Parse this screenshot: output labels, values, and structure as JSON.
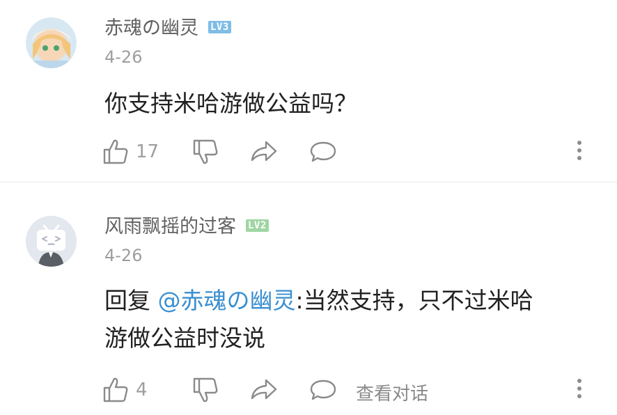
{
  "comments": [
    {
      "username": "赤魂の幽灵",
      "level": "LV3",
      "date": "4-26",
      "text": "你支持米哈游做公益吗？",
      "likes": "17",
      "level_color": "#7fbde6"
    },
    {
      "username": "风雨飘摇的过客",
      "level": "LV2",
      "date": "4-26",
      "reply_prefix": "回复 ",
      "mention": "@赤魂の幽灵",
      "text_line1": ":当然支持，只不过米哈",
      "text_line2": "游做公益时没说",
      "likes": "4",
      "view_conversation": "查看对话",
      "level_color": "#9fd6a4"
    }
  ],
  "colors": {
    "mention": "#3a8fd0",
    "muted": "#9e9e9e"
  },
  "icons": [
    "thumbs-up-icon",
    "thumbs-down-icon",
    "share-icon",
    "reply-bubble-icon",
    "more-vertical-icon"
  ]
}
